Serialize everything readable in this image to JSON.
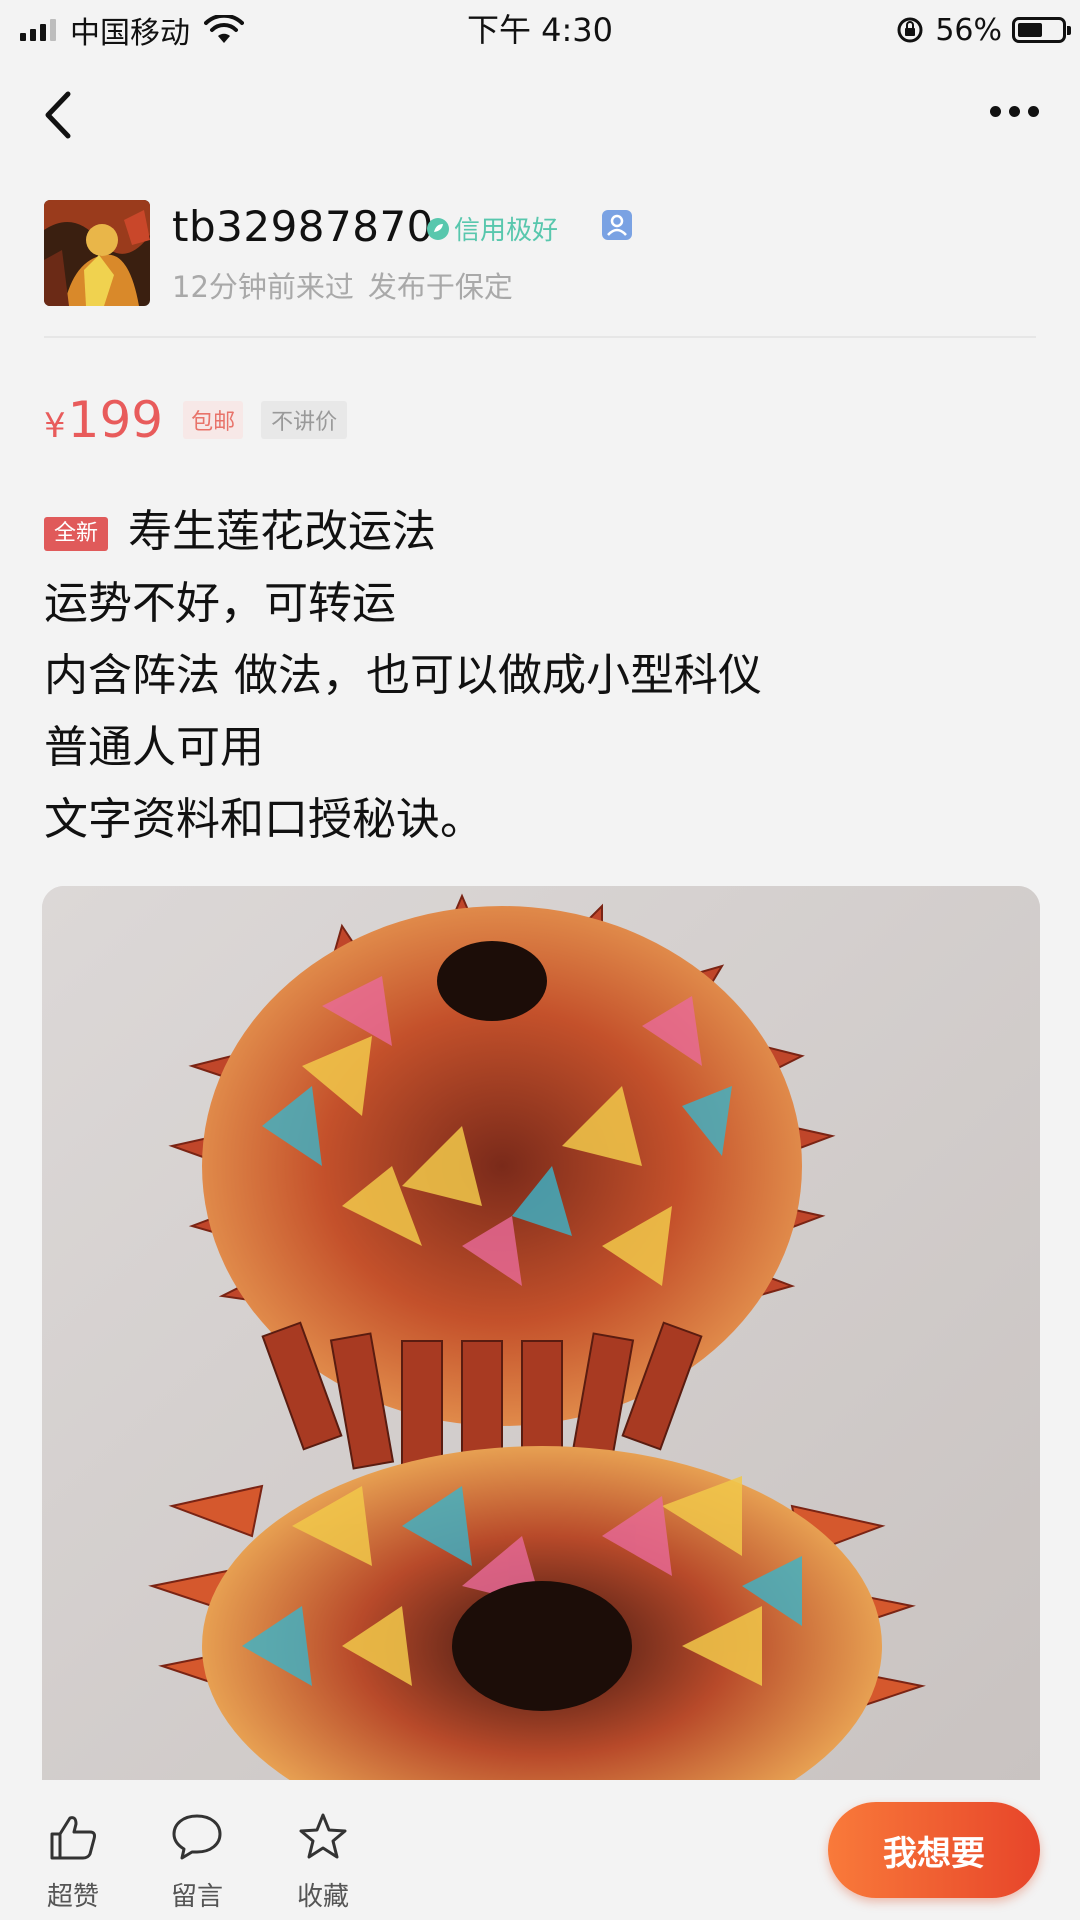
{
  "status_bar": {
    "carrier": "中国移动",
    "time": "下午 4:30",
    "battery_percent": "56%",
    "battery_level": 0.56
  },
  "nav": {
    "back_icon": "chevron-left-icon",
    "more_icon": "ellipsis-icon"
  },
  "seller": {
    "name": "tb32987870",
    "credit_label": "信用极好",
    "last_seen": "12分钟前来过",
    "published_at": "发布于保定"
  },
  "price": {
    "currency": "¥",
    "amount": "199",
    "shipping_tag": "包邮",
    "bargain_tag": "不讲价"
  },
  "item": {
    "condition_badge": "全新",
    "title": "寿生莲花改运法",
    "lines": [
      "运势不好，可转运",
      "内含阵法 做法，也可以做成小型科仪",
      "普通人可用",
      "文字资料和口授秘诀。"
    ]
  },
  "actions": {
    "like_label": "超赞",
    "comment_label": "留言",
    "favorite_label": "收藏",
    "want_label": "我想要"
  },
  "colors": {
    "price_red": "#e85b5b",
    "credit_green": "#58c7ad",
    "button_gradient_start": "#f97a3a",
    "button_gradient_end": "#e7452a"
  }
}
